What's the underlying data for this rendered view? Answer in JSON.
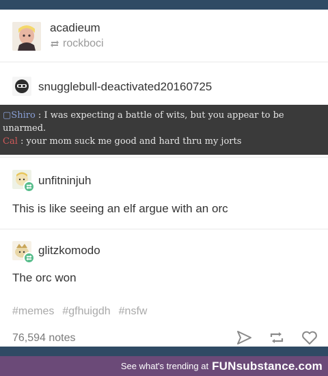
{
  "post": {
    "author": "acadieum",
    "reblogged_from": "rockboci",
    "thread": [
      {
        "username": "snugglebull-deactivated20160725",
        "chat": {
          "line1_speaker": "Shiro",
          "line1_text": "I was expecting a battle of wits, but you appear to be unarmed.",
          "line2_speaker": "Cal",
          "line2_text": "your mom suck me good and hard thru my jorts"
        }
      },
      {
        "username": "unfitninjuh",
        "text": "This is like seeing an elf argue with an orc"
      },
      {
        "username": "glitzkomodo",
        "text": "The orc won"
      }
    ],
    "tags": [
      "#memes",
      "#gfhuigdh",
      "#nsfw"
    ],
    "notes": "76,594 notes",
    "icons": [
      "share-icon",
      "reblog-icon",
      "like-icon"
    ]
  },
  "footer": {
    "text": "See what's trending at",
    "brand": "FUNsubstance.com"
  },
  "colors": {
    "page_bg": "#2f4a64",
    "footer_bg": "#6b4a78",
    "reblog_badge": "#56bc8a"
  }
}
